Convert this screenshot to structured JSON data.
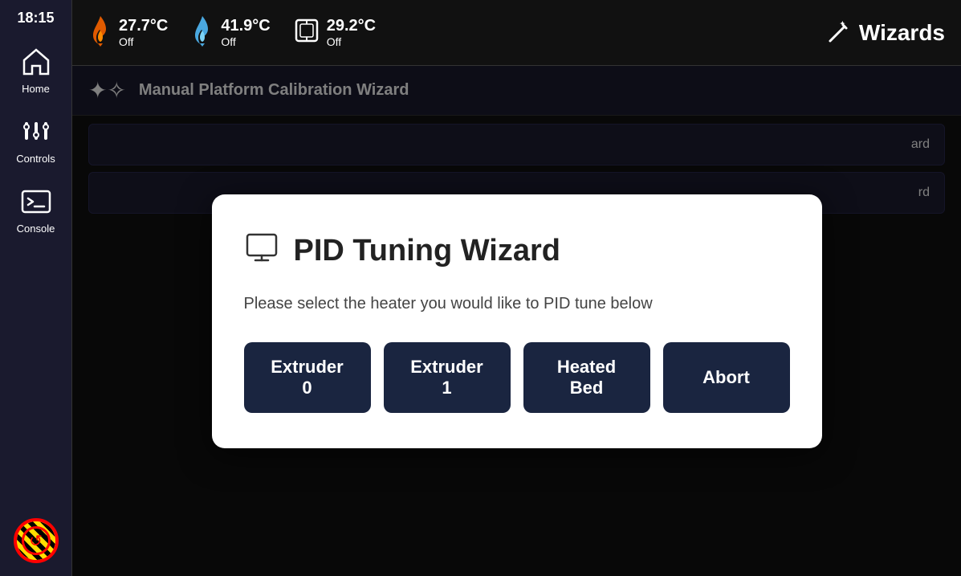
{
  "sidebar": {
    "time": "18:15",
    "items": [
      {
        "label": "Home",
        "icon": "home-icon"
      },
      {
        "label": "Controls",
        "icon": "controls-icon"
      },
      {
        "label": "Console",
        "icon": "console-icon"
      }
    ],
    "emergency_label": "Emergency Stop"
  },
  "topbar": {
    "hotend1": {
      "temp": "27.7°C",
      "status": "Off",
      "icon": "hotend1-icon"
    },
    "hotend2": {
      "temp": "41.9°C",
      "status": "Off",
      "icon": "hotend2-icon"
    },
    "chamber": {
      "temp": "29.2°C",
      "status": "Off",
      "icon": "chamber-icon"
    },
    "wizards_label": "Wizards",
    "wizards_icon": "wand-icon"
  },
  "wizard_header": {
    "title": "Manual Platform Calibration Wizard",
    "icon": "wand-icon"
  },
  "wizard_list": [
    {
      "text": "ard",
      "align": "right"
    },
    {
      "text": "rd",
      "align": "right"
    }
  ],
  "modal": {
    "title": "PID Tuning Wizard",
    "title_icon": "monitor-icon",
    "subtitle": "Please select the heater you would like to PID tune below",
    "buttons": [
      {
        "label": "Extruder 0",
        "name": "extruder0-button"
      },
      {
        "label": "Extruder 1",
        "name": "extruder1-button"
      },
      {
        "label": "Heated Bed",
        "name": "heated-bed-button"
      },
      {
        "label": "Abort",
        "name": "abort-button"
      }
    ]
  }
}
